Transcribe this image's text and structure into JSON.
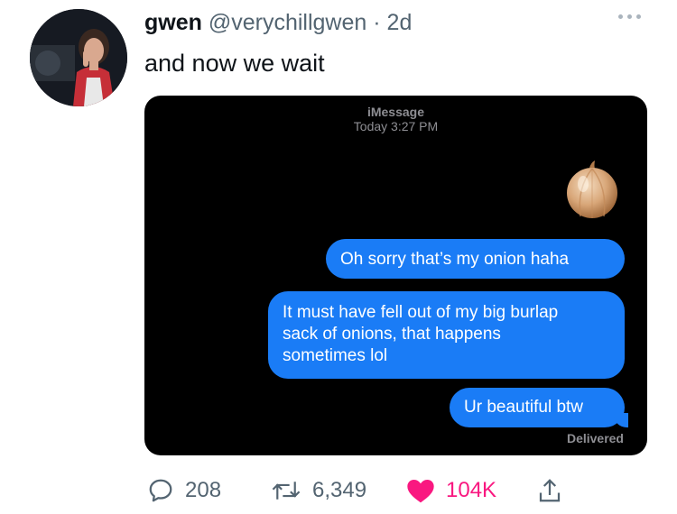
{
  "author": {
    "display_name": "gwen",
    "handle": "@verychillgwen",
    "separator": "·",
    "age": "2d",
    "avatar_icon": "profile-photo"
  },
  "tweet": {
    "text": "and now we wait"
  },
  "screenshot": {
    "service": "iMessage",
    "timestamp": "Today 3:27 PM",
    "emoji": "onion",
    "messages": [
      "Oh sorry that’s my onion haha",
      "It must have fell out of my big burlap\nsack of onions, that happens\nsometimes lol",
      "Ur beautiful btw"
    ],
    "status": "Delivered",
    "bubble_color": "#1a7cf6"
  },
  "actions": {
    "replies": "208",
    "retweets": "6,349",
    "likes": "104K",
    "like_color": "#f91880",
    "icons": [
      "reply-icon",
      "retweet-icon",
      "heart-icon",
      "share-icon"
    ]
  }
}
